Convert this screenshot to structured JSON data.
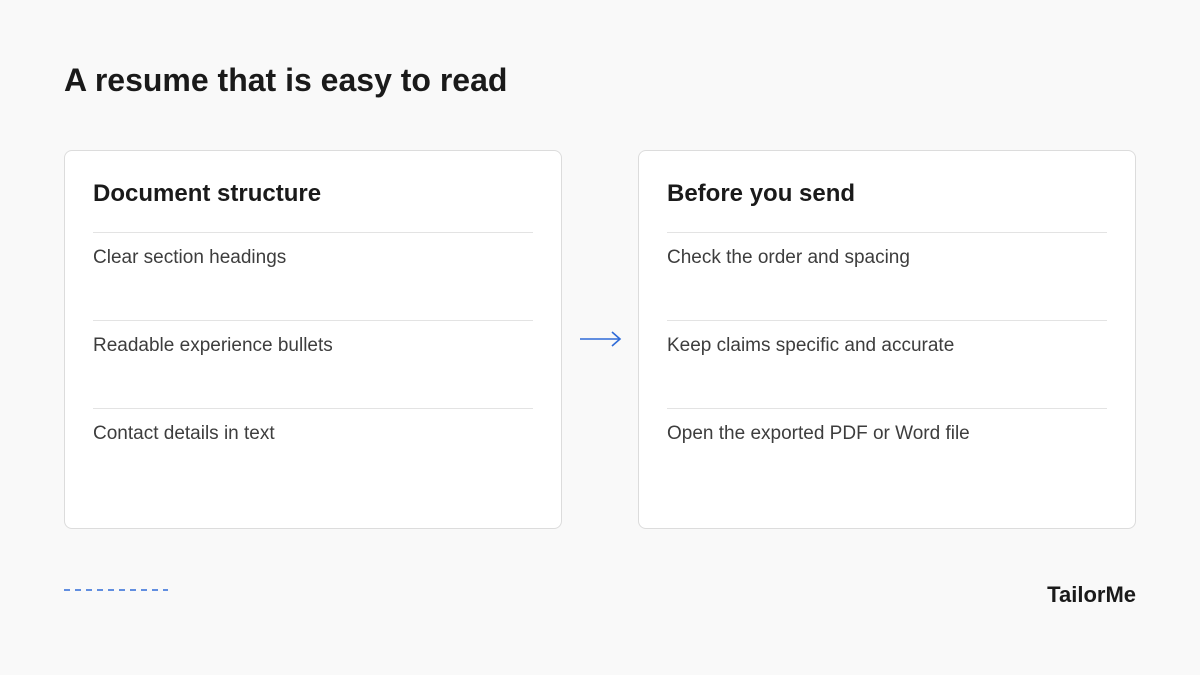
{
  "headline": "A resume that is easy to read",
  "accent_color": "#2f6bd8",
  "cards": [
    {
      "title": "Document structure",
      "items": [
        "Clear section headings",
        "Readable experience bullets",
        "Contact details in text"
      ]
    },
    {
      "title": "Before you send",
      "items": [
        "Check the order and spacing",
        "Keep claims specific and accurate",
        "Open the exported PDF or Word file"
      ]
    }
  ],
  "connector_icon": "right-arrow-icon",
  "decoration_icon": "dashed-line-icon",
  "brand": "TailorMe"
}
